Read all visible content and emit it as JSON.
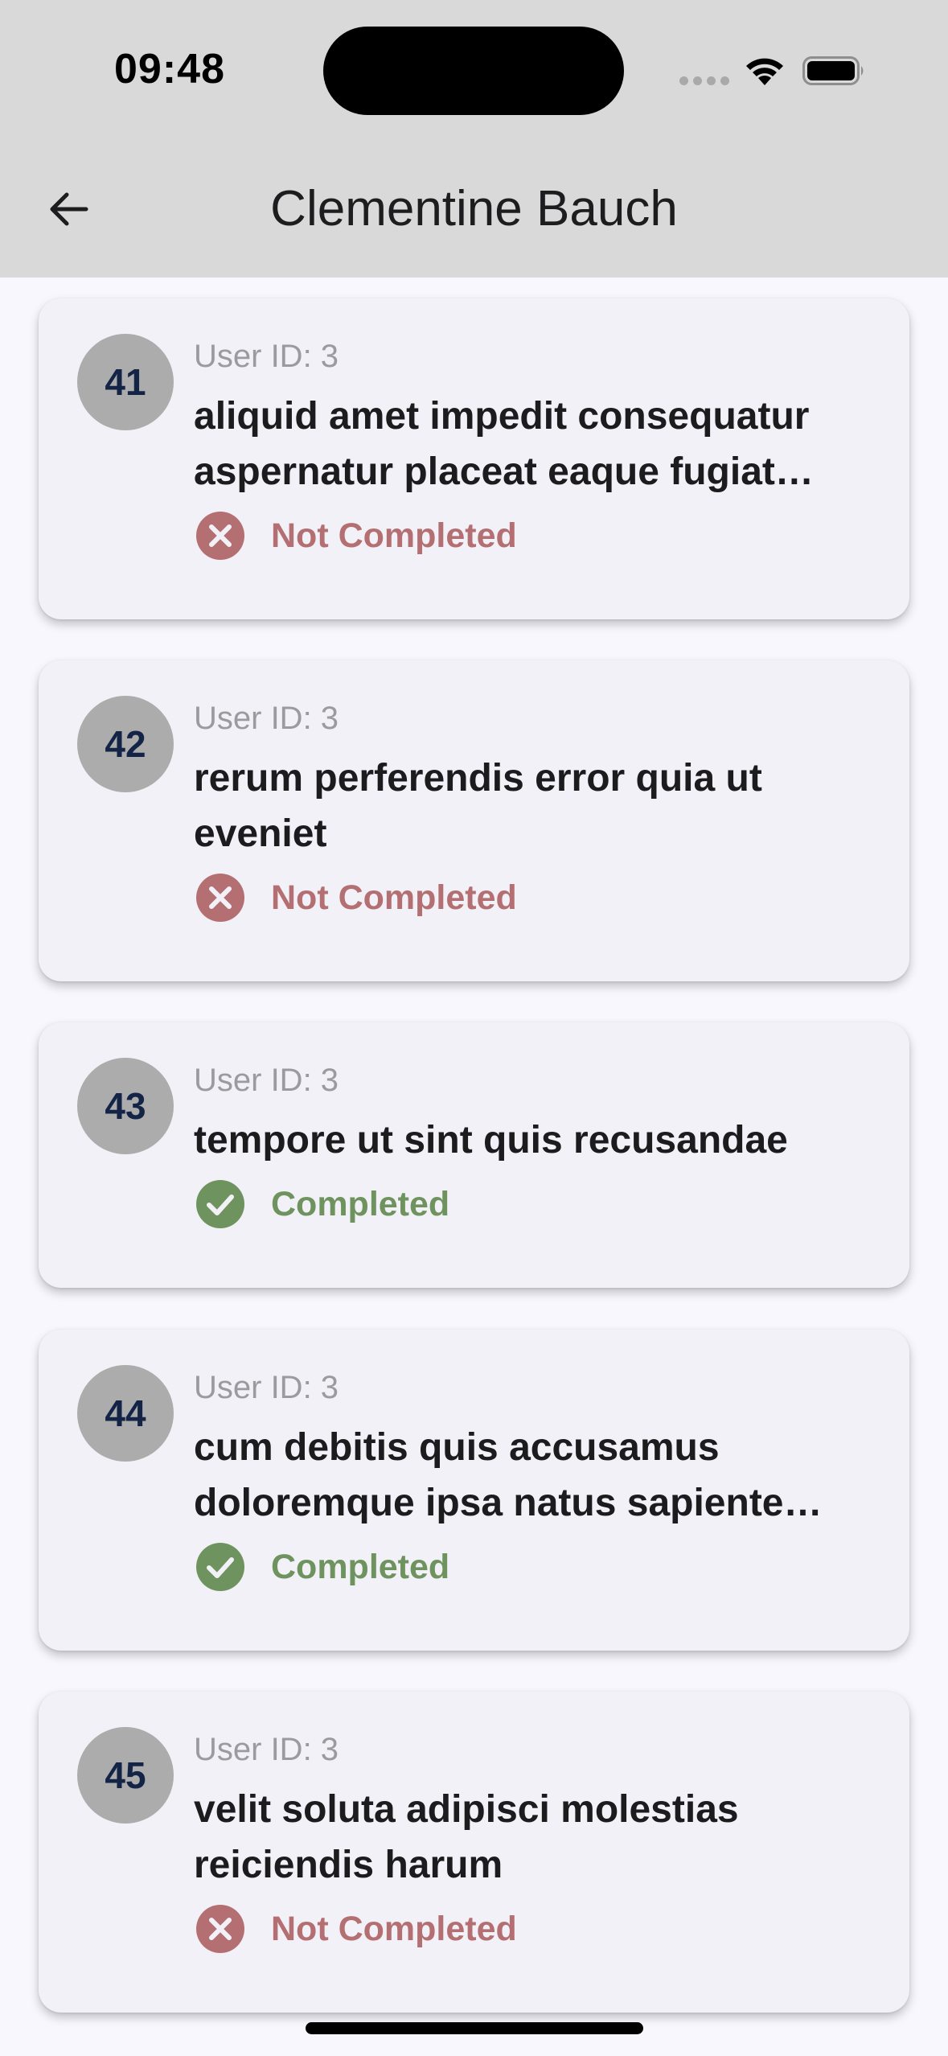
{
  "status_bar": {
    "time": "09:48"
  },
  "app_bar": {
    "title": "Clementine Bauch"
  },
  "colors": {
    "not_completed": "#b46f72",
    "completed": "#6f935e",
    "avatar_bg": "#acacac",
    "avatar_text": "#142447"
  },
  "todos": [
    {
      "id": "41",
      "user_id": "User ID: 3",
      "title": "aliquid amet impedit consequatur aspernatur placeat eaque fugiat suscipit",
      "status": "Not Completed",
      "completed": false,
      "icon": "cancel-icon"
    },
    {
      "id": "42",
      "user_id": "User ID: 3",
      "title": "rerum perferendis error quia ut eveniet",
      "status": "Not Completed",
      "completed": false,
      "icon": "cancel-icon"
    },
    {
      "id": "43",
      "user_id": "User ID: 3",
      "title": "tempore ut sint quis recusandae",
      "status": "Completed",
      "completed": true,
      "icon": "check-icon"
    },
    {
      "id": "44",
      "user_id": "User ID: 3",
      "title": "cum debitis quis accusamus doloremque ipsa natus sapiente omnis",
      "status": "Completed",
      "completed": true,
      "icon": "check-icon"
    },
    {
      "id": "45",
      "user_id": "User ID: 3",
      "title": "velit soluta adipisci molestias reiciendis harum",
      "status": "Not Completed",
      "completed": false,
      "icon": "cancel-icon"
    }
  ]
}
